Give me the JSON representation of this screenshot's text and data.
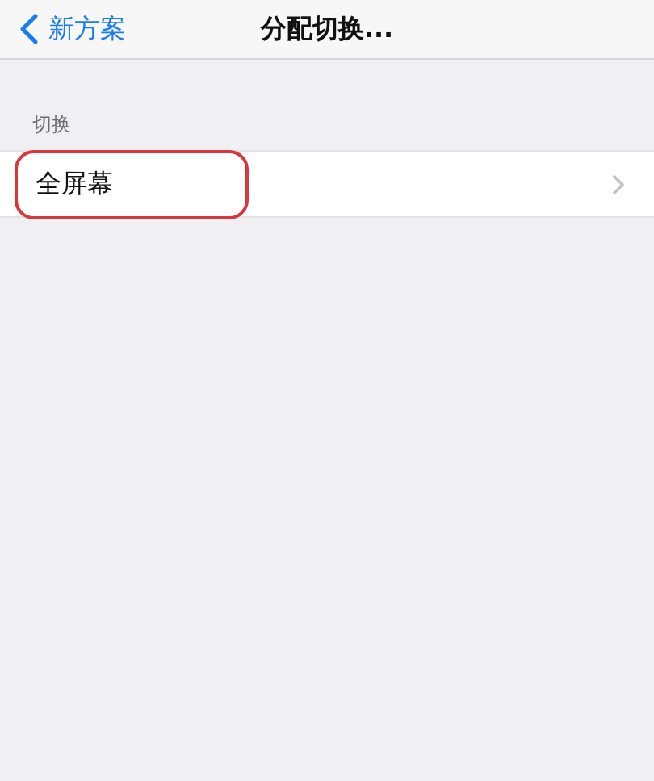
{
  "nav_bar": {
    "back_label": "新方案",
    "title": "分配切换..."
  },
  "section": {
    "header": "切换",
    "rows": [
      {
        "label": "全屏幕",
        "highlighted": true
      }
    ]
  }
}
